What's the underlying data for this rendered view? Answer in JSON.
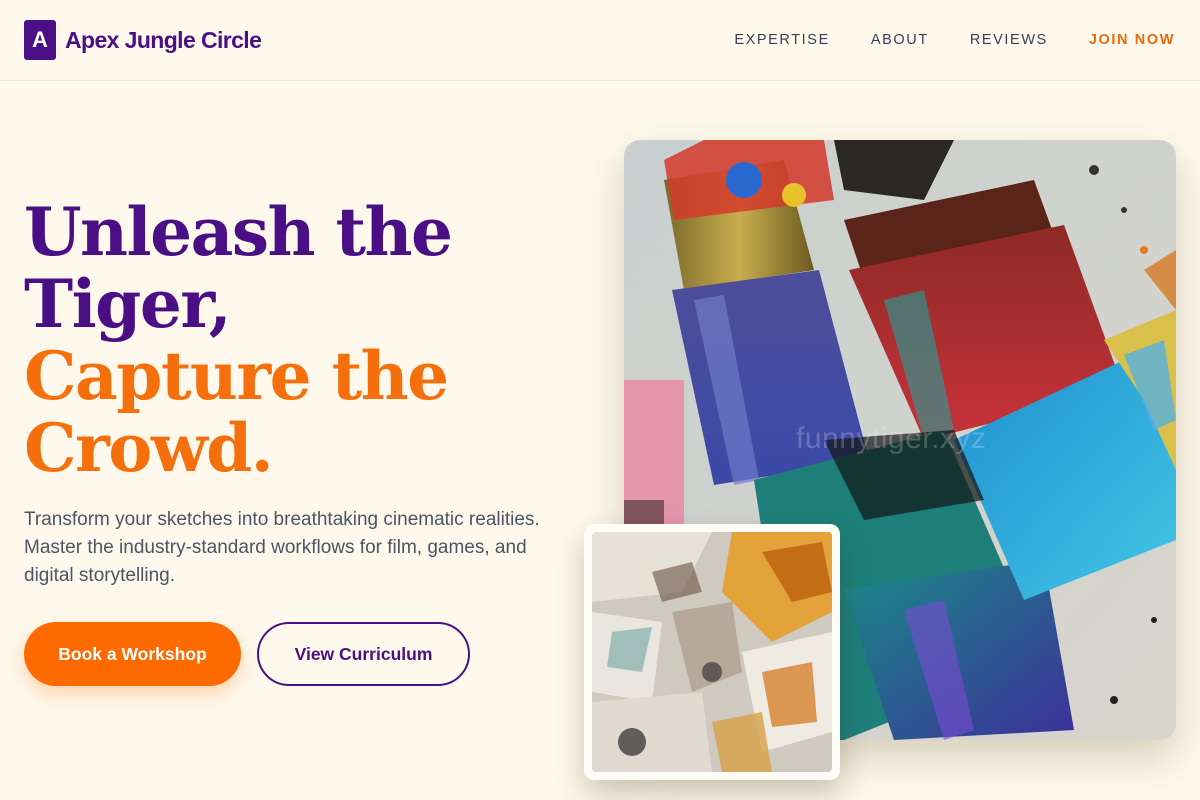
{
  "brand": {
    "mark": "A",
    "name": "Apex Jungle Circle"
  },
  "nav": {
    "items": [
      {
        "label": "EXPERTISE"
      },
      {
        "label": "ABOUT"
      },
      {
        "label": "REVIEWS"
      }
    ],
    "cta": "JOIN NOW"
  },
  "hero": {
    "title_line1": "Unleash the",
    "title_line2": "Tiger,",
    "title_line3": "Capture the",
    "title_line4": "Crowd.",
    "description": "Transform your sketches into breathtaking cinematic realities. Master the industry-standard workflows for film, games, and digital storytelling.",
    "primary_button": "Book a Workshop",
    "secondary_button": "View Curriculum"
  },
  "media": {
    "main_image_watermark": "funnytiger.xyz",
    "main_image_subject": "paint-brushes-photo",
    "inset_image_subject": "thick-paint-texture-photo"
  },
  "colors": {
    "background": "#fef9ec",
    "brand_purple": "#4b0f85",
    "accent_orange": "#ff6a00",
    "body_text": "#4b5563"
  }
}
